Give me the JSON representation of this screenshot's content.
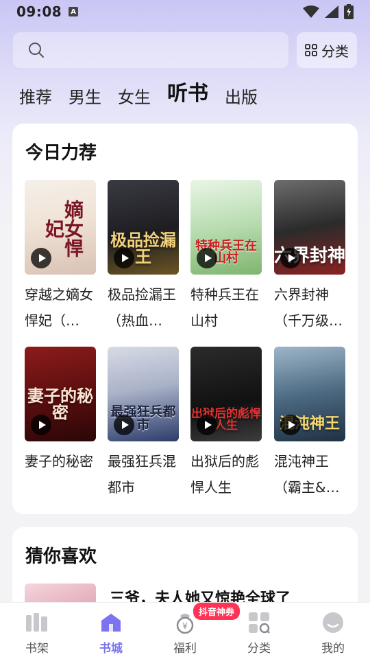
{
  "status_bar": {
    "time": "09:08",
    "notif_icon": "A"
  },
  "search": {
    "placeholder": "",
    "category_label": "分类"
  },
  "tabs": [
    {
      "label": "推荐",
      "active": false
    },
    {
      "label": "男生",
      "active": false
    },
    {
      "label": "女生",
      "active": false
    },
    {
      "label": "听书",
      "active": true
    },
    {
      "label": "出版",
      "active": false
    }
  ],
  "recommend": {
    "title": "今日力荐",
    "books": [
      {
        "title": "穿越之嫡女悍妃（…",
        "cover_text": "嫡女悍妃"
      },
      {
        "title": "极品捡漏王（热血…",
        "cover_text": "极品捡漏王"
      },
      {
        "title": "特种兵王在山村",
        "cover_text": "特种兵王在山村"
      },
      {
        "title": "六界封神（千万级…",
        "cover_text": "六界封神"
      },
      {
        "title": "妻子的秘密",
        "cover_text": "妻子的秘密"
      },
      {
        "title": "最强狂兵混都市",
        "cover_text": "最强狂兵都市"
      },
      {
        "title": "出狱后的彪悍人生",
        "cover_text": "出狱后的彪悍人生"
      },
      {
        "title": "混沌神王（霸主&…",
        "cover_text": "混沌神王"
      }
    ]
  },
  "guess": {
    "title": "猜你喜欢",
    "first_book_title": "三爷，夫人她又惊艳全球了"
  },
  "bottom_nav": [
    {
      "label": "书架",
      "icon": "bookshelf-icon",
      "active": false
    },
    {
      "label": "书城",
      "icon": "bookstore-icon",
      "active": true
    },
    {
      "label": "福利",
      "icon": "welfare-icon",
      "active": false,
      "badge": "抖音神券"
    },
    {
      "label": "分类",
      "icon": "category-icon",
      "active": false
    },
    {
      "label": "我的",
      "icon": "profile-icon",
      "active": false
    }
  ],
  "colors": {
    "accent": "#7b73f0",
    "badge": "#ff3355"
  }
}
